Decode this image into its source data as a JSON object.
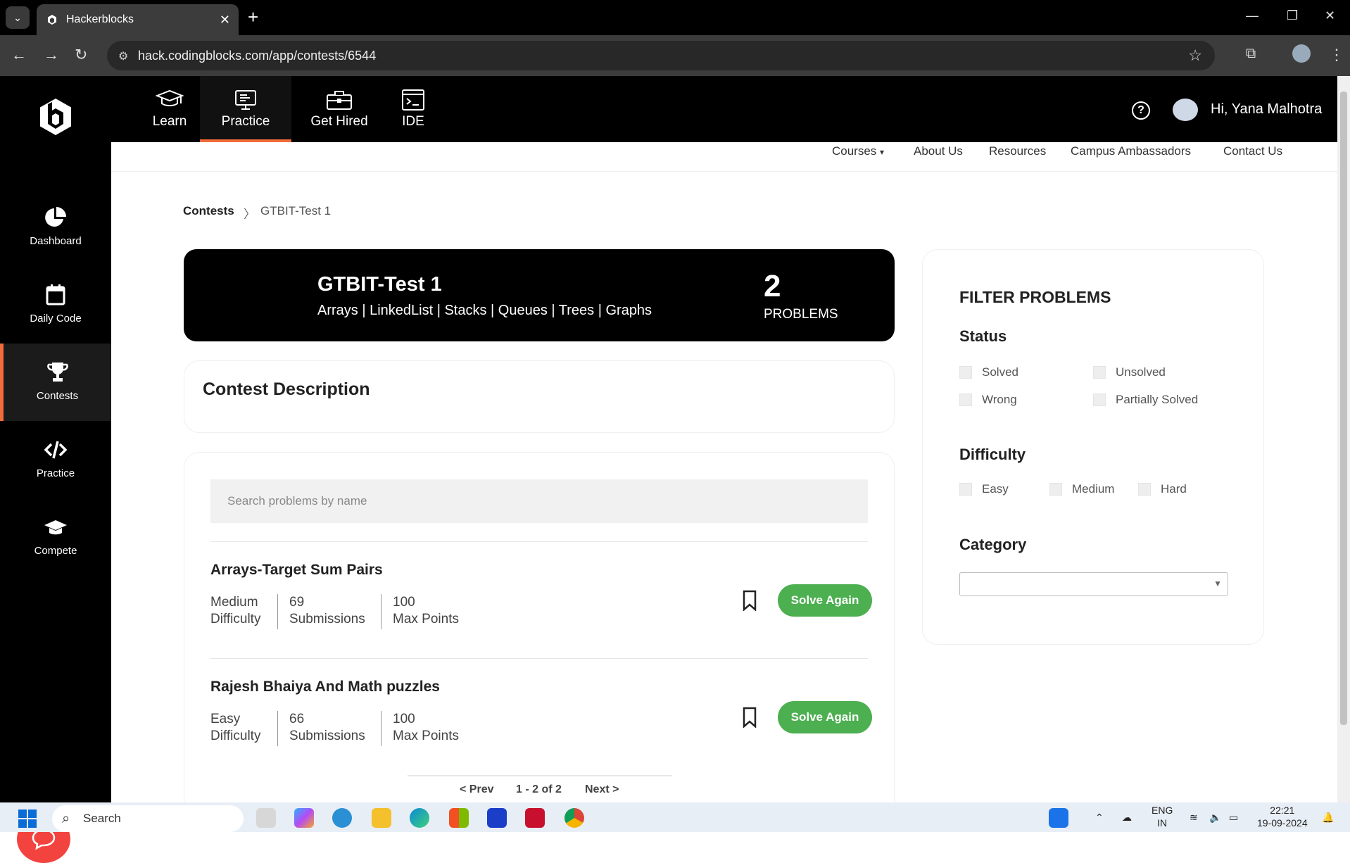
{
  "browser": {
    "tab_title": "Hackerblocks",
    "url": "hack.codingblocks.com/app/contests/6544"
  },
  "sidebar": {
    "items": [
      {
        "label": "Dashboard"
      },
      {
        "label": "Daily Code"
      },
      {
        "label": "Contests"
      },
      {
        "label": "Practice"
      },
      {
        "label": "Compete"
      }
    ]
  },
  "topnav": {
    "items": [
      {
        "label": "Learn"
      },
      {
        "label": "Practice"
      },
      {
        "label": "Get Hired"
      },
      {
        "label": "IDE"
      }
    ],
    "help": "?",
    "greeting": "Hi, Yana Malhotra"
  },
  "subnav": {
    "items": [
      "Courses",
      "About Us",
      "Resources",
      "Campus Ambassadors",
      "Contact Us"
    ]
  },
  "breadcrumb": {
    "root": "Contests",
    "separator": "〉",
    "current": "GTBIT-Test 1"
  },
  "contest": {
    "title": "GTBIT-Test 1",
    "tags": "Arrays | LinkedList | Stacks | Queues | Trees | Graphs",
    "problem_count": "2",
    "problem_label": "PROBLEMS",
    "description_title": "Contest Description"
  },
  "search": {
    "placeholder": "Search problems by name"
  },
  "problems": [
    {
      "title": "Arrays-Target Sum Pairs",
      "difficulty": "Medium",
      "difficulty_label": "Difficulty",
      "submissions": "69",
      "submissions_label": "Submissions",
      "points": "100",
      "points_label": "Max Points",
      "action": "Solve Again"
    },
    {
      "title": "Rajesh Bhaiya And Math puzzles",
      "difficulty": "Easy",
      "difficulty_label": "Difficulty",
      "submissions": "66",
      "submissions_label": "Submissions",
      "points": "100",
      "points_label": "Max Points",
      "action": "Solve Again"
    }
  ],
  "pagination": {
    "prev": "< Prev",
    "range": "1 - 2 of 2",
    "next": "Next >"
  },
  "filter": {
    "title": "FILTER PROBLEMS",
    "status_title": "Status",
    "status": [
      "Solved",
      "Unsolved",
      "Wrong",
      "Partially Solved"
    ],
    "difficulty_title": "Difficulty",
    "difficulty": [
      "Easy",
      "Medium",
      "Hard"
    ],
    "category_title": "Category"
  },
  "taskbar": {
    "search": "Search",
    "lang1": "ENG",
    "lang2": "IN",
    "time": "22:21",
    "date": "19-09-2024"
  },
  "colors": {
    "accent": "#f26b3a",
    "solve_button": "#4caf50",
    "chat_button": "#f2433f"
  }
}
